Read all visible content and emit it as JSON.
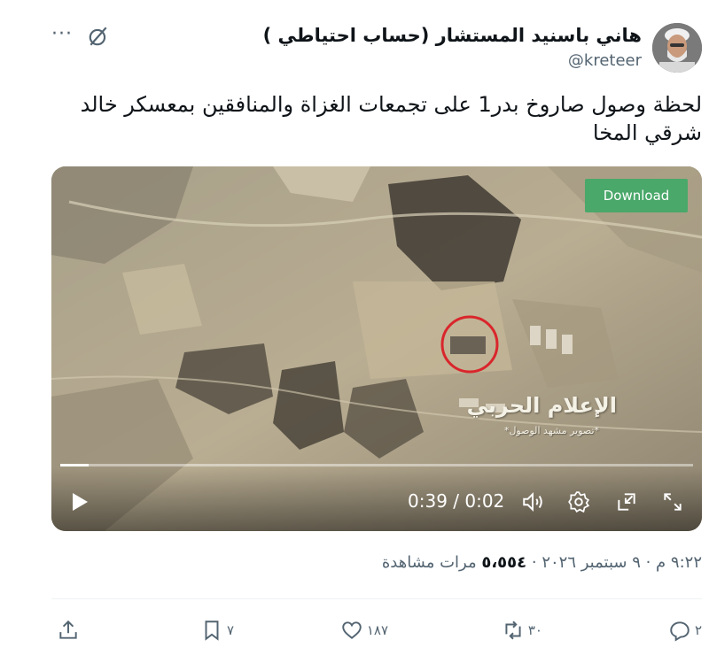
{
  "author": {
    "display_name": "هاني باسنيد المستشار (حساب احتياطي )",
    "handle": "@kreteer"
  },
  "tweet": {
    "text": "لحظة وصول صاروخ بدر1 على تجمعات الغزاة والمنافقين بمعسكر خالد شرقي المخا"
  },
  "video": {
    "download_label": "Download",
    "watermark_title": "الإعلام الحربي",
    "watermark_subtitle": "*تصوير مشهد الوصول*",
    "time_display": "0:39 / 0:02",
    "progress_fraction": 0.045
  },
  "meta": {
    "time": "٩:٢٢ م",
    "date": "٩ سبتمبر ٢٠٢٦",
    "views_count": "٥،٥٥٤",
    "views_label": "مرات مشاهدة"
  },
  "actions": {
    "reply_count": "٢",
    "repost_count": "٣٠",
    "like_count": "١٨٧",
    "bookmark_count": "٧"
  },
  "icons": [
    "more-icon",
    "grok-icon",
    "play-icon",
    "volume-icon",
    "settings-icon",
    "pip-icon",
    "fullscreen-icon",
    "reply-icon",
    "repost-icon",
    "like-icon",
    "bookmark-icon",
    "share-icon"
  ],
  "colors": {
    "text_primary": "#0f1419",
    "text_secondary": "#536471",
    "download_bg": "#4aa86a",
    "target_circle": "#d9262c"
  }
}
